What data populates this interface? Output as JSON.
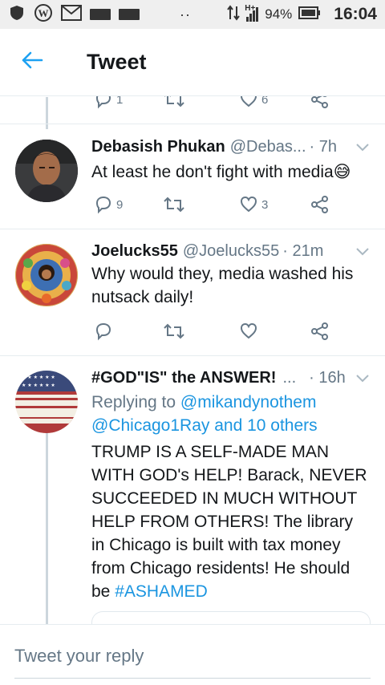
{
  "status_bar": {
    "battery": "94%",
    "time": "16:04",
    "network": "H+"
  },
  "header": {
    "title": "Tweet"
  },
  "partial_actions": {
    "reply_count": "1",
    "like_count": "6"
  },
  "tweets": [
    {
      "name": "Debasish Phukan",
      "handle": "@Debas...",
      "time": "· 7h",
      "text": "At least he don't fight with media😅",
      "reply_count": "9",
      "retweet_count": "",
      "like_count": "3"
    },
    {
      "name": "Joelucks55",
      "handle": "@Joelucks55",
      "time": "· 21m",
      "text": "Why would they, media washed his nutsack daily!",
      "reply_count": "",
      "retweet_count": "",
      "like_count": ""
    },
    {
      "name": "#GOD\"IS\" the ANSWER!",
      "handle": "...",
      "time": "· 16h",
      "replying_prefix": "Replying to",
      "replying_user": "@mikandynothem",
      "replying_line2": "@Chicago1Ray and 10 others",
      "text": "TRUMP IS A SELF-MADE MAN WITH GOD's HELP! Barack, NEVER SUCCEEDED IN MUCH WITHOUT HELP FROM OTHERS! The library in Chicago is built with tax money from Chicago residents! He should be",
      "hashtag": "#ASHAMED"
    }
  ],
  "composer": {
    "placeholder": "Tweet your reply"
  },
  "colors": {
    "accent": "#1da1f2",
    "secondary_text": "#657786",
    "divider": "#e6ecf0"
  }
}
